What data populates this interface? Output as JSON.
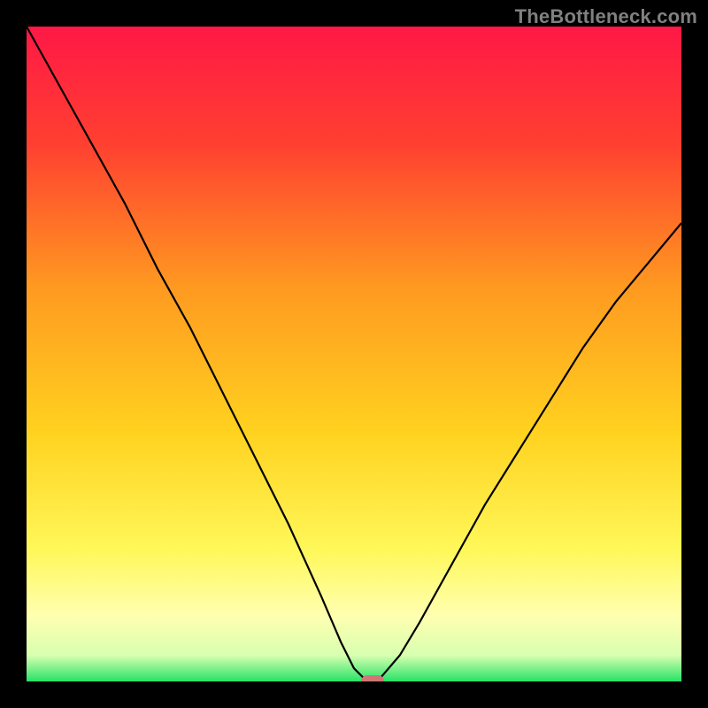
{
  "watermark": "TheBottleneck.com",
  "colors": {
    "gradient_top": "#ff1846",
    "gradient_mid_upper": "#ff6a2a",
    "gradient_mid": "#ffd21f",
    "gradient_pale": "#ffffb0",
    "gradient_bottom": "#27e367",
    "curve": "#000000",
    "marker": "#d07676",
    "frame": "#000000"
  },
  "chart_data": {
    "type": "line",
    "title": "",
    "xlabel": "",
    "ylabel": "",
    "xlim": [
      0,
      100
    ],
    "ylim": [
      0,
      100
    ],
    "grid": false,
    "series": [
      {
        "name": "bottleneck-curve",
        "x": [
          0,
          5,
          10,
          15,
          20,
          25,
          30,
          35,
          40,
          45,
          48,
          50,
          52,
          53,
          54,
          57,
          60,
          65,
          70,
          75,
          80,
          85,
          90,
          95,
          100
        ],
        "y": [
          100,
          91,
          82,
          73,
          63,
          54,
          44,
          34,
          24,
          13,
          6,
          2,
          0,
          0,
          0.5,
          4,
          9,
          18,
          27,
          35,
          43,
          51,
          58,
          64,
          70
        ]
      }
    ],
    "marker": {
      "x": 52.8,
      "y": 0
    },
    "annotations": []
  }
}
